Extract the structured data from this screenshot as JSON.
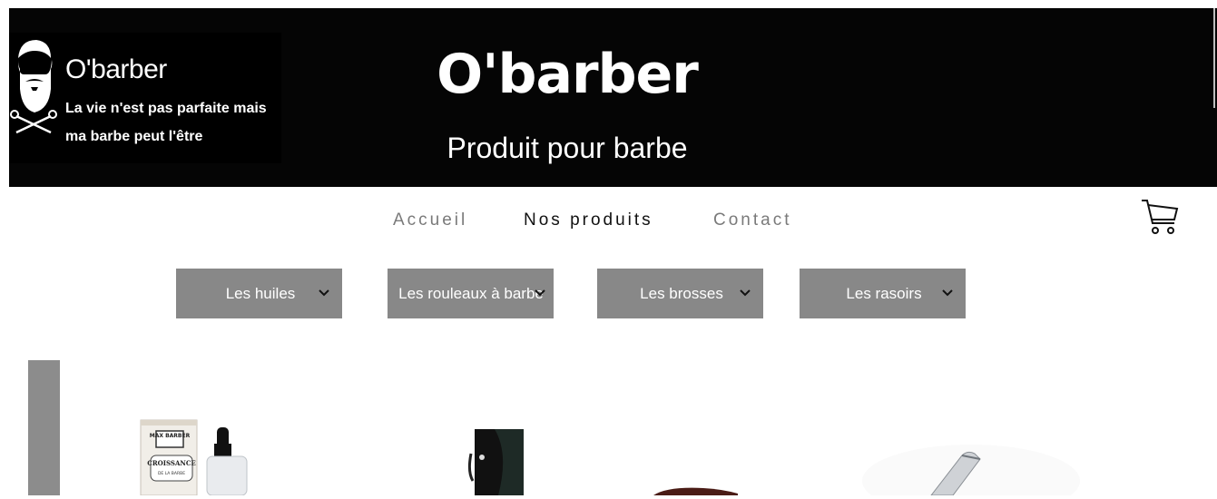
{
  "header": {
    "logo": {
      "title": "O'barber",
      "tagline": "La vie n'est pas parfaite mais ma barbe peut l'être",
      "icon": "bearded-man-scissors-icon"
    },
    "title": "O'barber",
    "subtitle": "Produit pour barbe",
    "background": "#050505"
  },
  "nav": {
    "items": [
      {
        "label": "Accueil",
        "active": false
      },
      {
        "label": "Nos produits",
        "active": true
      },
      {
        "label": "Contact",
        "active": false
      }
    ],
    "cart_icon": "shopping-cart-icon"
  },
  "categories": [
    {
      "label": "Les huiles",
      "icon": "chevron-down-icon"
    },
    {
      "label": "Les rouleaux à barbe",
      "icon": "chevron-down-icon"
    },
    {
      "label": "Les brosses",
      "icon": "chevron-down-icon"
    },
    {
      "label": "Les rasoirs",
      "icon": "chevron-down-icon"
    }
  ],
  "products": {
    "items": [
      {
        "image": "beard-oil-bottle-image",
        "box_text": [
          "MAX BARBER",
          "CROISSANCE",
          "DE LA BARBE"
        ]
      },
      {
        "image": "beard-roller-box-image"
      },
      {
        "image": "beard-brush-image"
      },
      {
        "image": "straight-razor-image"
      }
    ]
  },
  "colors": {
    "accent_dropdown": "#888888",
    "nav_inactive": "#7a7a7a",
    "nav_active": "#111111"
  }
}
